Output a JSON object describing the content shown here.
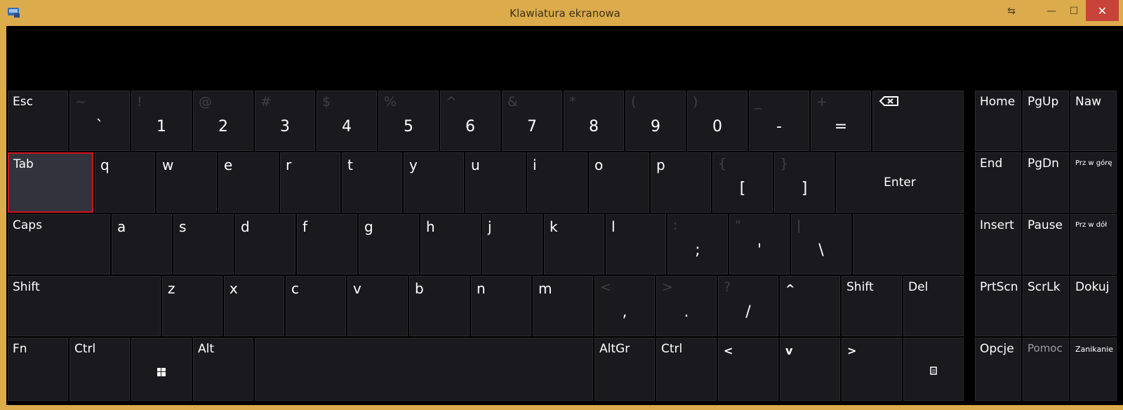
{
  "window": {
    "title": "Klawiatura ekranowa",
    "controls": {
      "restore": "⇆",
      "minimize": "—",
      "maximize": "☐",
      "close": "✕"
    }
  },
  "colors": {
    "frame": "#dcab4c",
    "key": "#1a1a1e",
    "key_selected": "#33333d",
    "selection_border": "#d2141c"
  },
  "keys": {
    "esc": "Esc",
    "backtick": {
      "shift": "~",
      "base": "`"
    },
    "digits": [
      {
        "shift": "!",
        "base": "1"
      },
      {
        "shift": "@",
        "base": "2"
      },
      {
        "shift": "#",
        "base": "3"
      },
      {
        "shift": "$",
        "base": "4"
      },
      {
        "shift": "%",
        "base": "5"
      },
      {
        "shift": "^",
        "base": "6"
      },
      {
        "shift": "&",
        "base": "7"
      },
      {
        "shift": "*",
        "base": "8"
      },
      {
        "shift": "(",
        "base": "9"
      },
      {
        "shift": ")",
        "base": "0"
      },
      {
        "shift": "_",
        "base": "-"
      },
      {
        "shift": "+",
        "base": "="
      }
    ],
    "tab": "Tab",
    "row_q": [
      "q",
      "w",
      "e",
      "r",
      "t",
      "y",
      "u",
      "i",
      "o",
      "p"
    ],
    "brackets": [
      {
        "shift": "{",
        "base": "["
      },
      {
        "shift": "}",
        "base": "]"
      }
    ],
    "enter": "Enter",
    "caps": "Caps",
    "row_a": [
      "a",
      "s",
      "d",
      "f",
      "g",
      "h",
      "j",
      "k",
      "l"
    ],
    "row_a_symbols": [
      {
        "shift": ":",
        "base": ";"
      },
      {
        "shift": "\"",
        "base": "'"
      },
      {
        "shift": "|",
        "base": "\\"
      }
    ],
    "shift": "Shift",
    "row_z": [
      "z",
      "x",
      "c",
      "v",
      "b",
      "n",
      "m"
    ],
    "row_z_symbols": [
      {
        "shift": "<",
        "base": ","
      },
      {
        "shift": ">",
        "base": "."
      },
      {
        "shift": "?",
        "base": "/"
      }
    ],
    "up_arrow": "^",
    "shift_right": "Shift",
    "del": "Del",
    "fn": "Fn",
    "ctrl": "Ctrl",
    "alt": "Alt",
    "altgr": "AltGr",
    "ctrl_right": "Ctrl",
    "left_arrow": "<",
    "down_arrow": "v",
    "right_arrow": ">"
  },
  "nav": {
    "home": "Home",
    "pgup": "PgUp",
    "naw": "Naw",
    "end": "End",
    "pgdn": "PgDn",
    "przwgore": "Prz w górę",
    "insert": "Insert",
    "pause": "Pause",
    "przwdol": "Prz w dół",
    "prtscn": "PrtScn",
    "scrlk": "ScrLk",
    "dokuj": "Dokuj",
    "opcje": "Opcje",
    "pomoc": "Pomoc",
    "zanikanie": "Zanikanie"
  }
}
